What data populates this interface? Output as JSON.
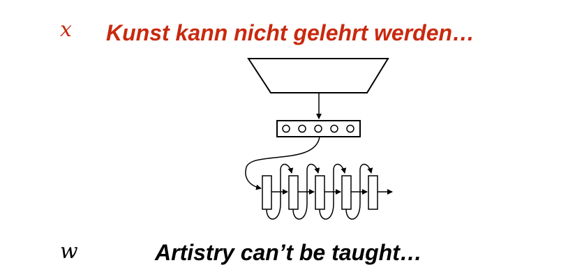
{
  "source": {
    "variable": "x",
    "text": "Kunst kann nicht gelehrt werden…",
    "color": "#c8290f"
  },
  "target": {
    "variable": "w",
    "text": "Artistry can’t be taught…",
    "color": "#000000"
  },
  "diagram": {
    "encoder_shape": "trapezoid",
    "encoding_vector_units": 5,
    "decoder_steps": 5
  }
}
